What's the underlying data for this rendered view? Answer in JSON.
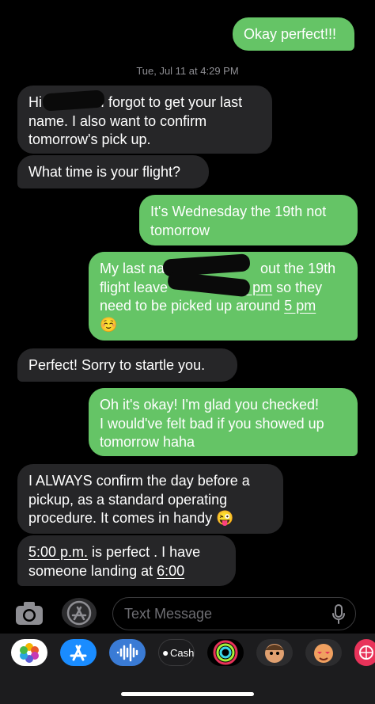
{
  "thread": {
    "first_sent": "Okay perfect!!!",
    "timestamp": "Tue, Jul 11 at 4:29 PM",
    "msg1": {
      "l1a": "Hi",
      "l1b": "I forgot to get your last",
      "l2": "name. I also want to confirm",
      "l3": "tomorrow's pick up."
    },
    "msg2": "What time is your flight?",
    "msg3": {
      "l1": "It's Wednesday the 19th not",
      "l2": "tomorrow"
    },
    "msg4": {
      "l1a": "My last name",
      "l1b": "out the 19th",
      "l2a": "flight leave",
      "l2b": "t",
      "l2c": "8 pm",
      "l2d": "so they",
      "l3a": "need to be picked up around",
      "l3b": "5 pm",
      "l4": "☺️"
    },
    "msg5": "Perfect! Sorry to startle you.",
    "msg6": {
      "l1": "Oh it's okay! I'm glad you checked!",
      "l2": "I would've felt bad if you showed up",
      "l3": "tomorrow haha"
    },
    "msg7": {
      "l1": "I ALWAYS confirm the day before a",
      "l2": "pickup, as a standard operating",
      "l3": "procedure. It comes in handy",
      "emoji": "😜"
    },
    "msg8": {
      "l1a": "5:00 p.m.",
      "l1b": " is perfect .  I have",
      "l2a": "someone landing at ",
      "l2b": "6:00"
    }
  },
  "composer": {
    "placeholder": "Text Message"
  },
  "dock": {
    "cash_label": "Cash"
  },
  "colors": {
    "sent": "#65c466",
    "received": "#262628",
    "background": "#000000"
  }
}
